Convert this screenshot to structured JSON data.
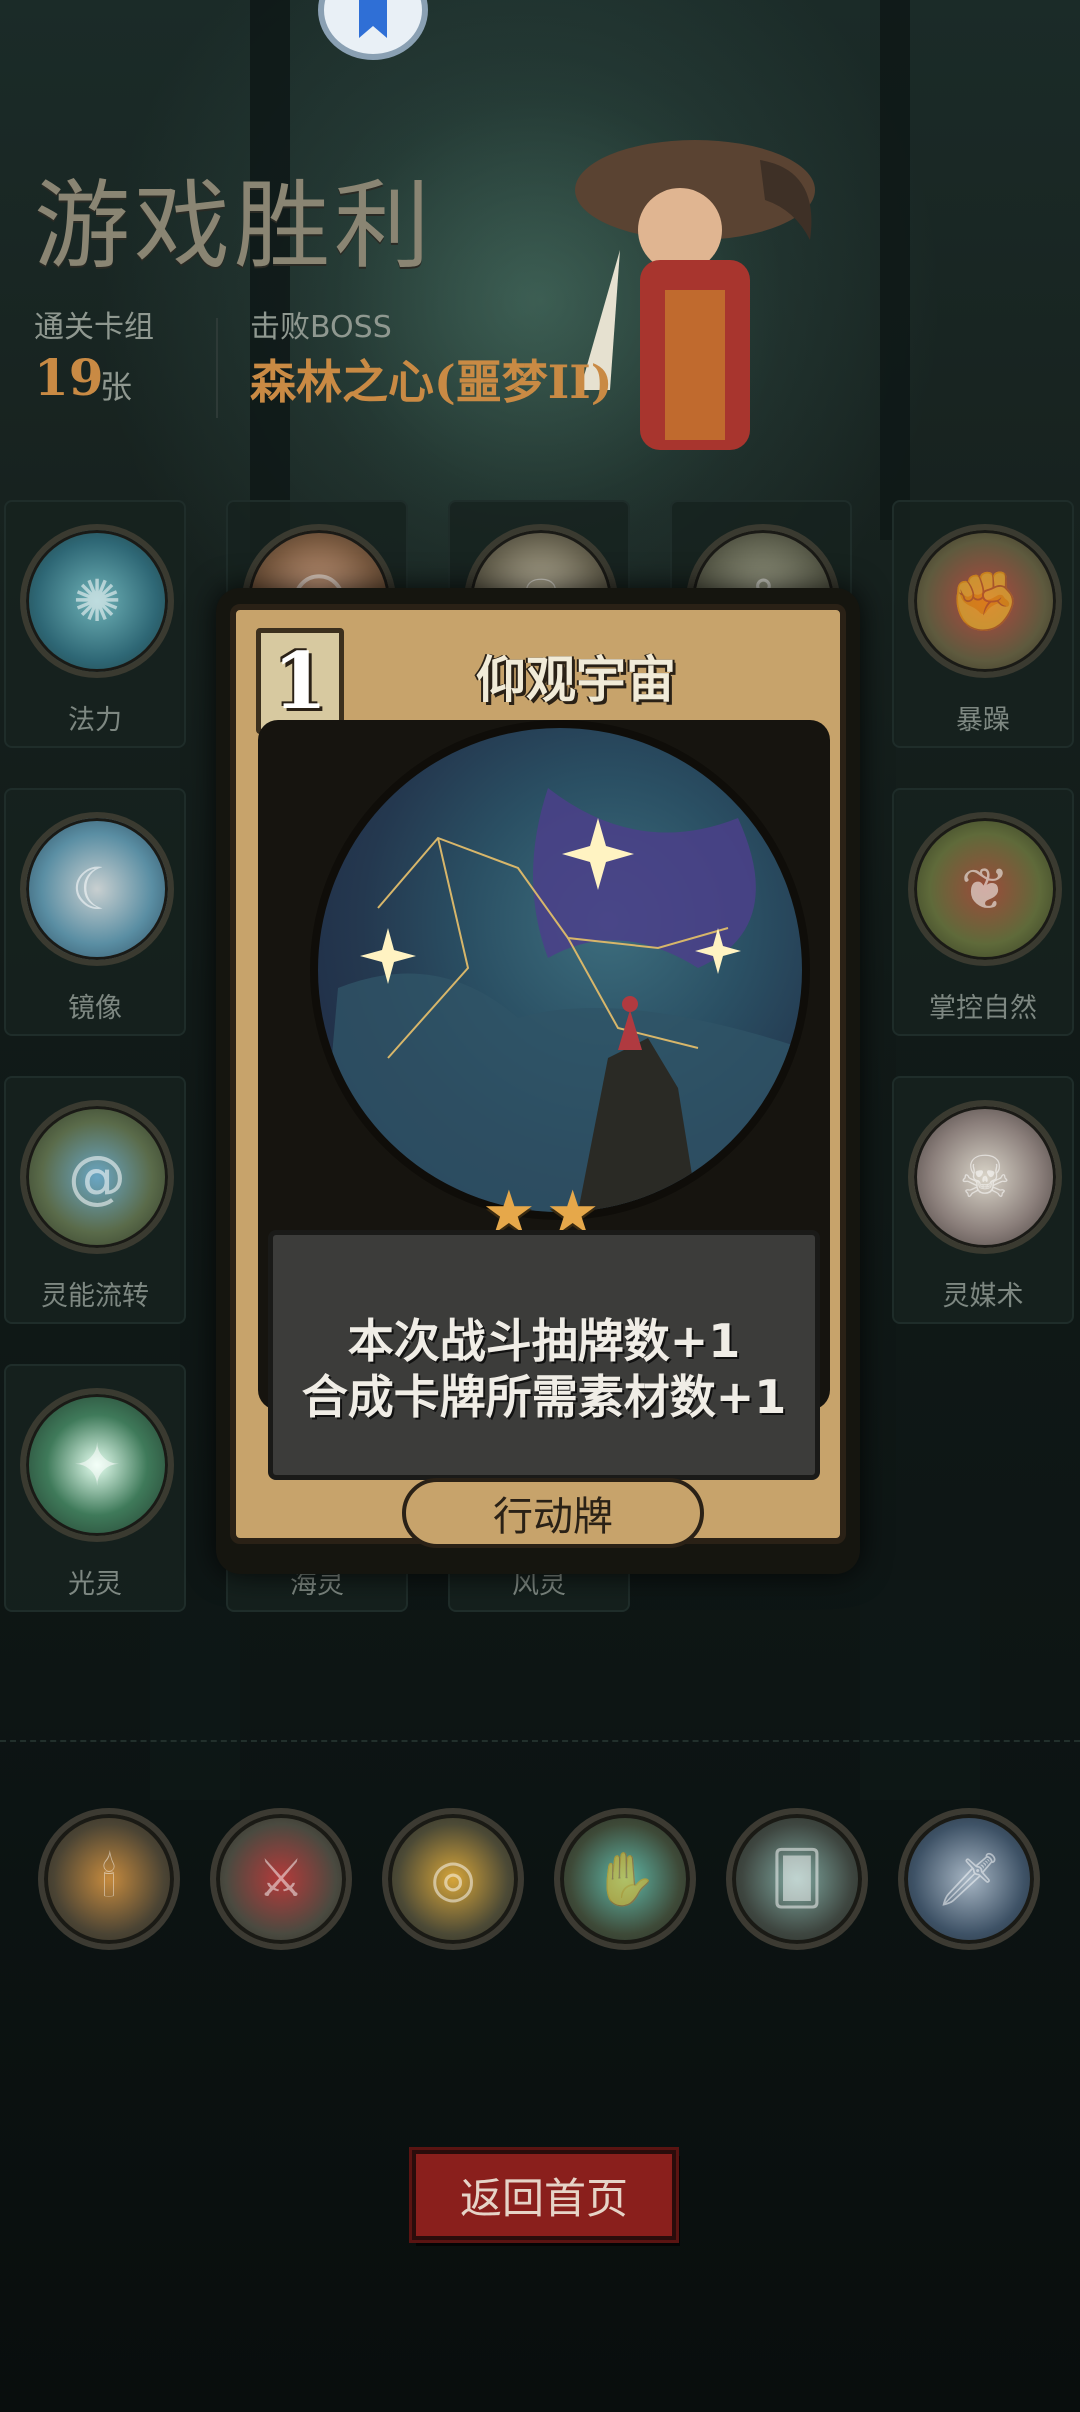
{
  "header": {
    "title": "游戏胜利",
    "deck_label": "通关卡组",
    "deck_count": "19",
    "deck_unit": "张",
    "boss_label": "击败BOSS",
    "boss_name": "森林之心(噩梦II)"
  },
  "skills": [
    {
      "label": "法力",
      "icon": "mana-orb-icon"
    },
    {
      "label": "",
      "icon": "grinning-hero-icon"
    },
    {
      "label": "",
      "icon": "feathered-skull-icon"
    },
    {
      "label": "",
      "icon": "hook-icon"
    },
    {
      "label": "暴躁",
      "icon": "angry-brute-icon"
    },
    {
      "label": "镜像",
      "icon": "mirror-moon-icon"
    },
    {
      "label": "掌控自然",
      "icon": "nature-vines-icon"
    },
    {
      "label": "灵能流转",
      "icon": "psychic-swirl-icon"
    },
    {
      "label": "灵媒术",
      "icon": "skull-ritual-icon"
    },
    {
      "label": "光灵",
      "icon": "light-spirit-icon"
    },
    {
      "label": "海灵",
      "icon": "sea-spirit-icon"
    },
    {
      "label": "风灵",
      "icon": "wind-spirit-icon"
    }
  ],
  "card": {
    "cost": "1",
    "name": "仰观宇宙",
    "stars": 2,
    "desc_line1": "本次战斗抽牌数+1",
    "desc_line2": "合成卡牌所需素材数+1",
    "type": "行动牌"
  },
  "relics": [
    {
      "icon": "candle-hand-icon"
    },
    {
      "icon": "red-hood-attack-icon"
    },
    {
      "icon": "gold-coins-hand-icon"
    },
    {
      "icon": "spirit-hand-icon"
    },
    {
      "icon": "card-hand-icon"
    },
    {
      "icon": "dagger-icon"
    }
  ],
  "footer": {
    "home_button": "返回首页"
  },
  "colors": {
    "accent_gold": "#c98a44",
    "card_frame": "#c7a36b",
    "button_red": "#8a1f1c",
    "star": "#e6a84a"
  }
}
